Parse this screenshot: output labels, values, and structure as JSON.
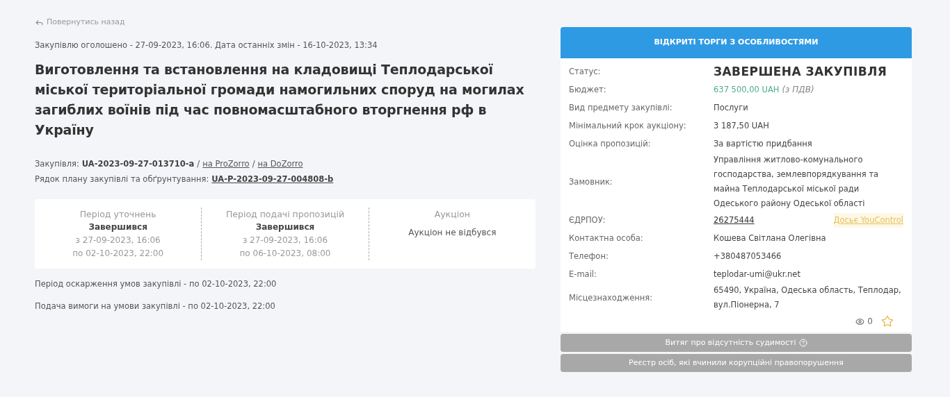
{
  "back_link": "Повернутись назад",
  "announced": "Закупівлю оголошено - 27-09-2023, 16:06. Дата останніх змін - 16-10-2023, 13:34",
  "title": "Виготовлення та встановлення на кладовищі Теплодарської міської територіальної громади намогильних споруд на могилах загиблих воїнів під час повномасштабного вторгнення рф в Україну",
  "procurement": {
    "label": "Закупівля:",
    "id": "UA-2023-09-27-013710-a",
    "links": [
      {
        "separator": "/",
        "label": "на ProZorro"
      },
      {
        "separator": "/",
        "label": "на DoZorro"
      }
    ]
  },
  "plan": {
    "label": "Рядок плану закупівлі та обґрунтування:",
    "id": "UA-P-2023-09-27-004808-b"
  },
  "periods": [
    {
      "title": "Період уточнень",
      "status": "Завершився",
      "lines": [
        "з 27-09-2023, 16:06",
        "по 02-10-2023, 22:00"
      ]
    },
    {
      "title": "Період подачі пропозицій",
      "status": "Завершився",
      "lines": [
        "з 27-09-2023, 16:06",
        "по 06-10-2023, 08:00"
      ]
    },
    {
      "title": "Аукціон",
      "lines": [
        "Аукціон не відбувся"
      ]
    }
  ],
  "deadlines": [
    "Період оскарження умов закупівлі - по 02-10-2023, 22:00",
    "Подача вимоги на умови закупівлі - по 02-10-2023, 22:00"
  ],
  "card": {
    "header": "ВІДКРИТІ ТОРГИ З ОСОБЛИВОСТЯМИ",
    "rows": [
      {
        "kind": "status",
        "label": "Статус:",
        "value": "ЗАВЕРШЕНА ЗАКУПІВЛЯ"
      },
      {
        "kind": "budget",
        "label": "Бюджет:",
        "value": "637 500,00 UAH",
        "note": "(з ПДВ)"
      },
      {
        "kind": "text",
        "label": "Вид предмету закупівлі:",
        "value": "Послуги"
      },
      {
        "kind": "text",
        "label": "Мінімальний крок аукціону:",
        "value": "3 187,50 UAH"
      },
      {
        "kind": "text",
        "label": "Оцінка пропозицій:",
        "value": "За вартістю придбання"
      },
      {
        "kind": "text",
        "label": "Замовник:",
        "value": "Управління житлово-комунального господарства, землевпорядкування та майна Теплодарської міської ради Одеського району Одеської області"
      },
      {
        "kind": "code",
        "label": "ЄДРПОУ:",
        "value": "26275444",
        "extra": "Досьє YouControl"
      },
      {
        "kind": "text",
        "label": "Контактна особа:",
        "value": "Кошева Світлана Олегівна"
      },
      {
        "kind": "text",
        "label": "Телефон:",
        "value": "+380487053466"
      },
      {
        "kind": "text",
        "label": "E-mail:",
        "value": "teplodar-umi@ukr.net"
      },
      {
        "kind": "text",
        "label": "Місцезнаходження:",
        "value": "65490, Україна, Одеська область, Теплодар, вул.Піонерна, 7"
      }
    ],
    "views": "0",
    "favorite": false
  },
  "buttons": [
    {
      "label": "Витяг про відсутність судимості",
      "help": true
    },
    {
      "label": "Реєстр осіб, які вчинили корупційні правопорушення",
      "help": false
    }
  ]
}
